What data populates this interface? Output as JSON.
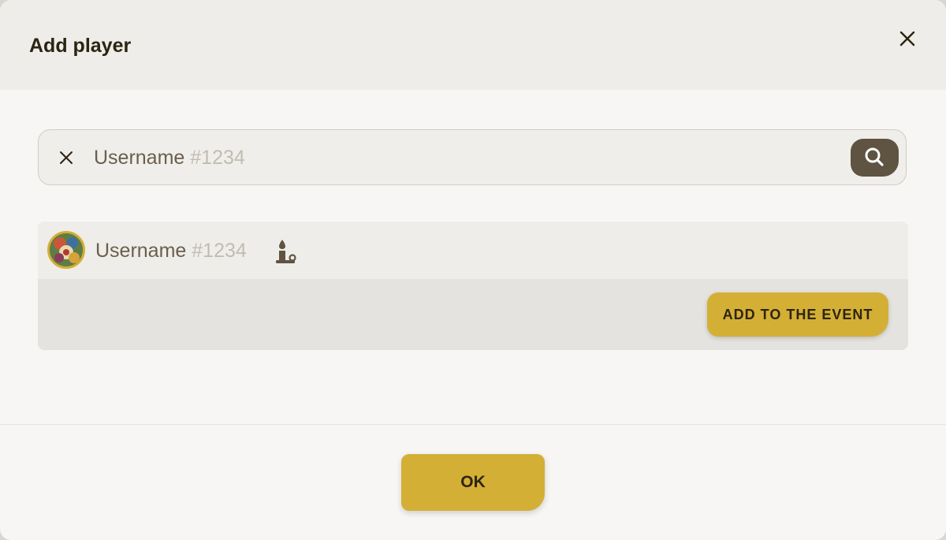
{
  "dialog": {
    "title": "Add player",
    "close_icon": "close-icon"
  },
  "search": {
    "clear_icon": "close-icon",
    "value_name": "Username",
    "value_tag": "#1234",
    "search_icon": "search-icon"
  },
  "result": {
    "avatar": "avatar-image",
    "name": "Username",
    "tag": "#1234",
    "badge_icon": "candle-icon",
    "add_button_label": "ADD TO THE EVENT"
  },
  "footer": {
    "ok_label": "OK"
  },
  "colors": {
    "accent": "#d4af35",
    "dark": "#5f5441",
    "title_text": "#2c2412",
    "muted_text": "#6a5f4d",
    "tag_text": "#c1bcb2"
  }
}
